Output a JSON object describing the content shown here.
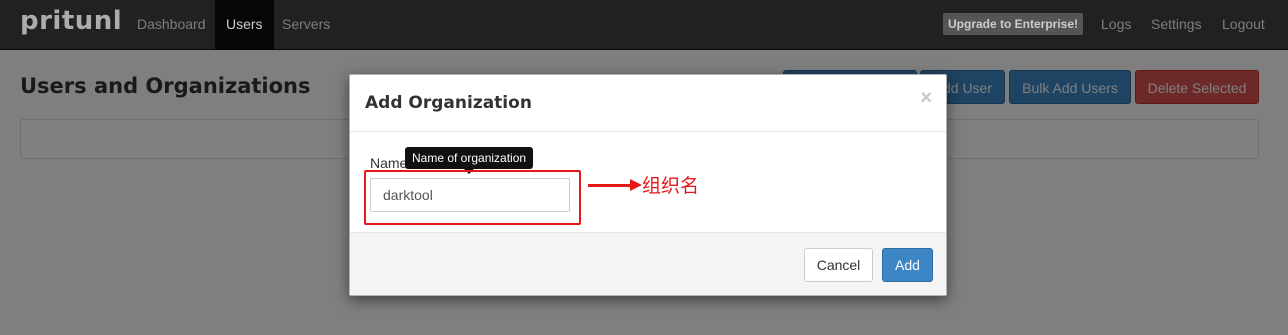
{
  "app": {
    "brand": "pritunl"
  },
  "nav": {
    "items": [
      {
        "label": "Dashboard"
      },
      {
        "label": "Users"
      },
      {
        "label": "Servers"
      }
    ],
    "upgrade_label": "Upgrade to Enterprise!",
    "right_items": [
      {
        "label": "Logs"
      },
      {
        "label": "Settings"
      },
      {
        "label": "Logout"
      }
    ]
  },
  "page": {
    "title": "Users and Organizations",
    "buttons": {
      "add_org": "",
      "add_user": "Add User",
      "bulk_add": "Bulk Add Users",
      "delete_selected": "Delete Selected"
    }
  },
  "modal": {
    "title": "Add Organization",
    "close": "×",
    "field_label": "Name",
    "tooltip": "Name of organization",
    "name_value": "darktool",
    "annotation": "组织名",
    "cancel_label": "Cancel",
    "add_label": "Add"
  },
  "colors": {
    "primary": "#3d86c6",
    "danger": "#d9534f",
    "annotation": "#e81818",
    "navbar": "#2a2a2a"
  }
}
